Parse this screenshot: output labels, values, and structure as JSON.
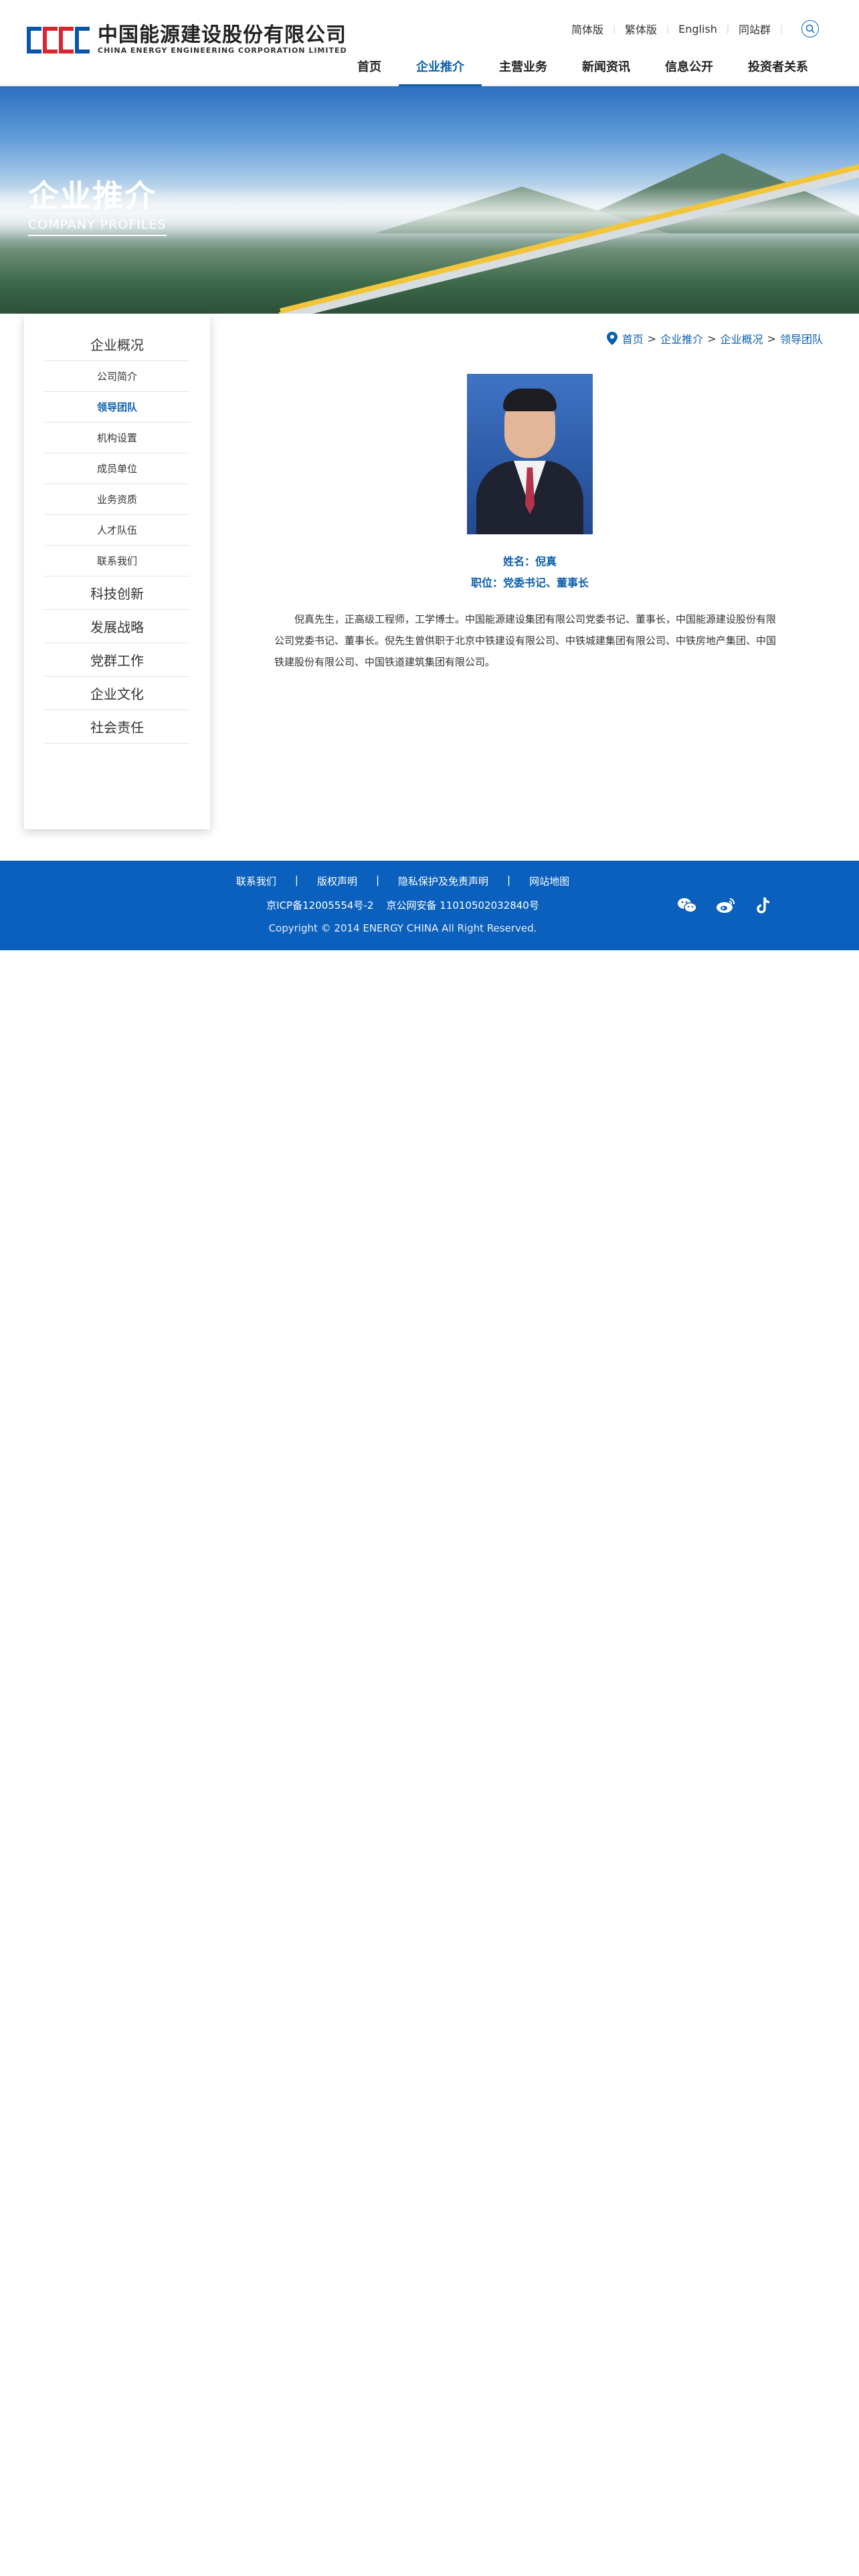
{
  "brand": {
    "logo_cn": "中国能源建设股份有限公司",
    "logo_en": "CHINA ENERGY ENGINEERING CORPORATION LIMITED"
  },
  "toplinks": [
    "简体版",
    "繁体版",
    "English",
    "同站群"
  ],
  "nav": [
    {
      "label": "首页",
      "active": false
    },
    {
      "label": "企业推介",
      "active": true
    },
    {
      "label": "主营业务",
      "active": false
    },
    {
      "label": "新闻资讯",
      "active": false
    },
    {
      "label": "信息公开",
      "active": false
    },
    {
      "label": "投资者关系",
      "active": false
    }
  ],
  "banner": {
    "title": "企业推介",
    "subtitle": "COMPANY PROFILES"
  },
  "sidebar": {
    "section": "企业概况",
    "subitems": [
      "公司简介",
      "领导团队",
      "机构设置",
      "成员单位",
      "业务资质",
      "人才队伍",
      "联系我们"
    ],
    "active_subitem": "领导团队",
    "sections": [
      "科技创新",
      "发展战略",
      "党群工作",
      "企业文化",
      "社会责任"
    ]
  },
  "breadcrumb": [
    "首页",
    "企业推介",
    "企业概况",
    "领导团队"
  ],
  "person": {
    "name": "姓名：倪真",
    "position": "职位：党委书记、董事长",
    "bio": "倪真先生，正高级工程师，工学博士。中国能源建设集团有限公司党委书记、董事长，中国能源建设股份有限公司党委书记、董事长。倪先生曾供职于北京中铁建设有限公司、中铁城建集团有限公司、中铁房地产集团、中国铁建股份有限公司、中国铁道建筑集团有限公司。"
  },
  "footer": {
    "links": [
      "联系我们",
      "版权声明",
      "隐私保护及免责声明",
      "网站地图"
    ],
    "icp": "京ICP备12005554号-2    京公网安备 11010502032840号",
    "copyright": "Copyright © 2014 ENERGY CHINA All Right Reserved."
  },
  "colors": {
    "accent": "#0a5fae",
    "footer_bg": "#0a60bc",
    "logo_red": "#d7262e",
    "logo_blue": "#0a57a8"
  }
}
